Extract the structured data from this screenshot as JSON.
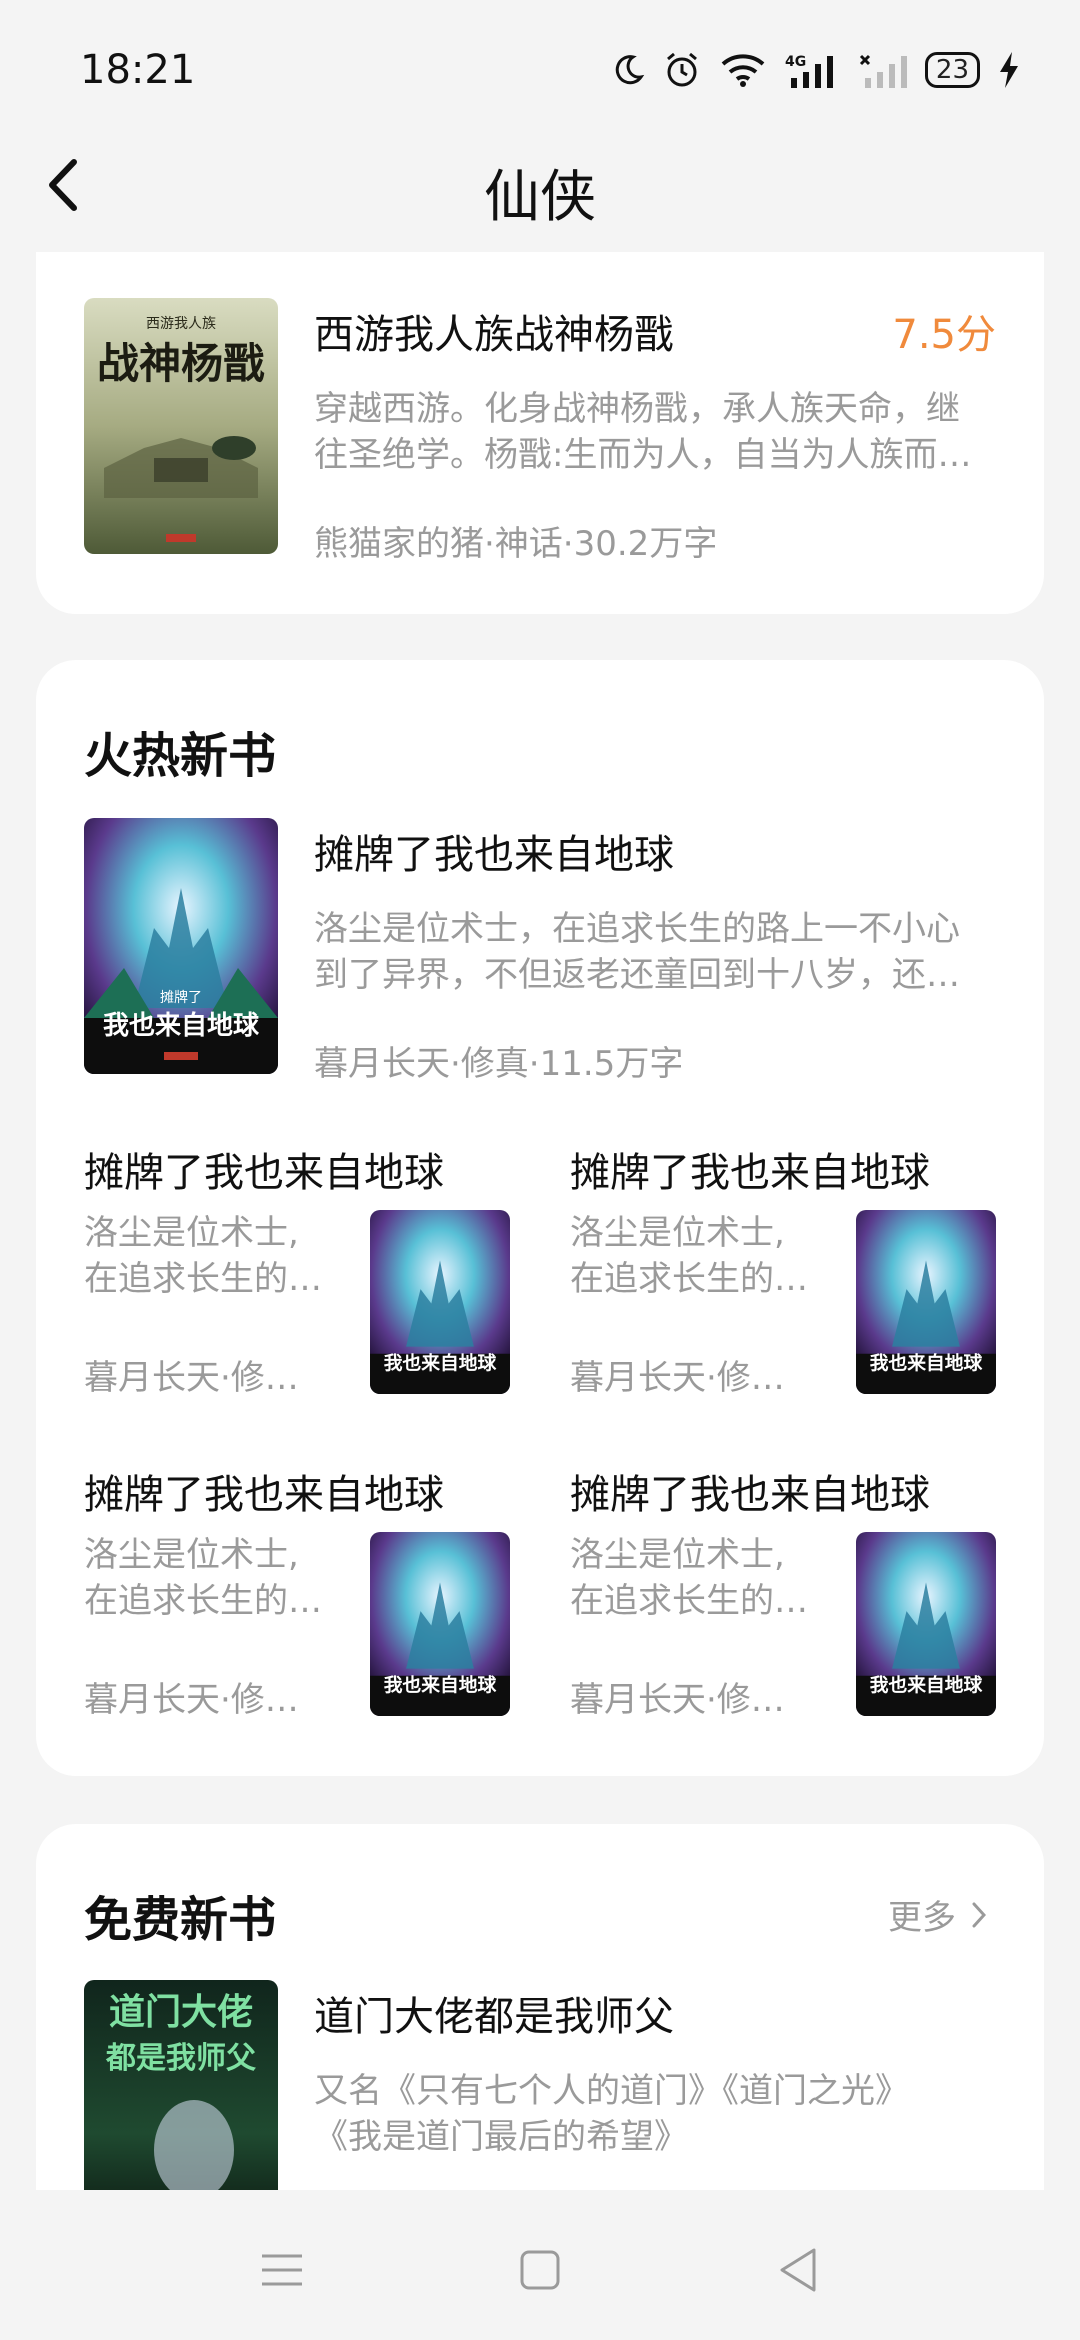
{
  "status_bar": {
    "time": "18:21",
    "network": "4G",
    "battery": "23"
  },
  "header": {
    "title": "仙侠"
  },
  "featured_book": {
    "title": "西游我人族战神杨戬",
    "score": "7.5分",
    "desc_line1": "穿越西游。化身战神杨戬，承人族天命，继",
    "desc_line2": "往圣绝学。杨戬:生而为人，自当为人族而…",
    "meta": "熊猫家的猪·神话·30.2万字",
    "cover_text": "战神杨戬",
    "cover_small_text": "西游我人族"
  },
  "hot_section": {
    "title": "火热新书",
    "lead_book": {
      "title": "摊牌了我也来自地球",
      "desc_line1": "洛尘是位术士，在追求长生的路上一不小心",
      "desc_line2": "到了异界，不但返老还童回到十八岁，还…",
      "meta": "暮月长天·修真·11.5万字",
      "cover_text": "我也来自地球",
      "cover_small_text": "摊牌了"
    },
    "grid_books": [
      {
        "title": "摊牌了我也来自地球",
        "desc_line1": "洛尘是位术士,",
        "desc_line2": "在追求长生的…",
        "meta": "暮月长天·修…",
        "cover_text": "我也来自地球"
      },
      {
        "title": "摊牌了我也来自地球",
        "desc_line1": "洛尘是位术士,",
        "desc_line2": "在追求长生的…",
        "meta": "暮月长天·修…",
        "cover_text": "我也来自地球"
      },
      {
        "title": "摊牌了我也来自地球",
        "desc_line1": "洛尘是位术士,",
        "desc_line2": "在追求长生的…",
        "meta": "暮月长天·修…",
        "cover_text": "我也来自地球"
      },
      {
        "title": "摊牌了我也来自地球",
        "desc_line1": "洛尘是位术士,",
        "desc_line2": "在追求长生的…",
        "meta": "暮月长天·修…",
        "cover_text": "我也来自地球"
      }
    ]
  },
  "free_section": {
    "title": "免费新书",
    "more_label": "更多",
    "lead_book": {
      "title": "道门大佬都是我师父",
      "desc_line1": "又名《只有七个人的道门》《道门之光》",
      "desc_line2": "《我是道门最后的希望》",
      "cover_text_1": "道门大佬",
      "cover_text_2": "都是我师父"
    }
  },
  "colors": {
    "accent_score": "#f08a3c",
    "muted_text": "#9a9a9a",
    "background": "#f4f4f4"
  }
}
